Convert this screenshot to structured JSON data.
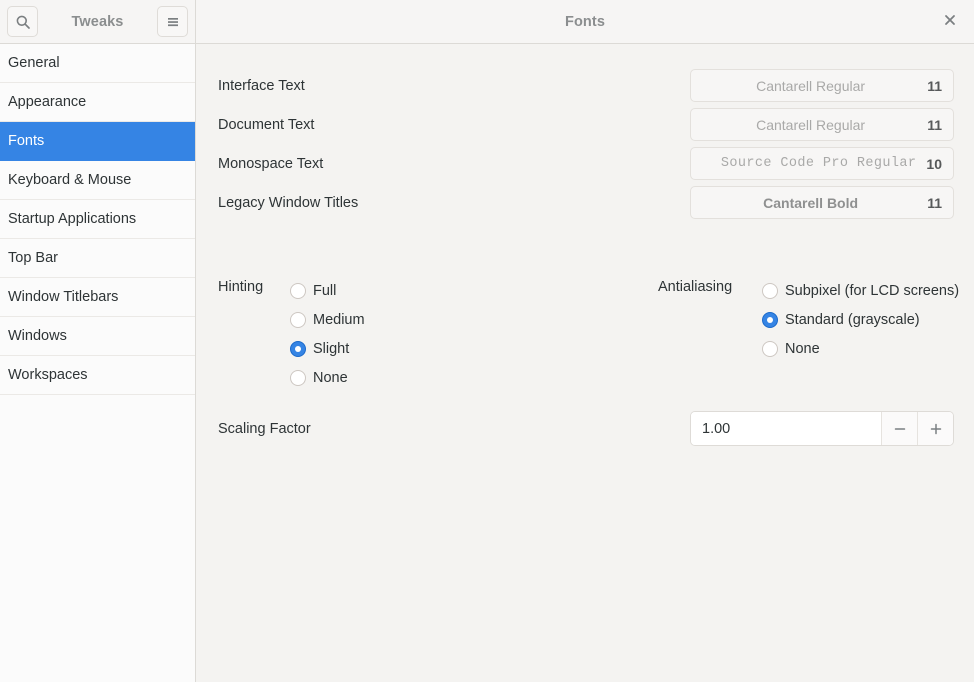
{
  "window": {
    "app_title": "Tweaks",
    "page_title": "Fonts",
    "search_icon": "search-icon",
    "menu_icon": "hamburger-menu-icon",
    "close_icon": "close-icon",
    "accent_color": "#3584e4"
  },
  "sidebar": {
    "items": [
      {
        "label": "General",
        "selected": false
      },
      {
        "label": "Appearance",
        "selected": false
      },
      {
        "label": "Fonts",
        "selected": true
      },
      {
        "label": "Keyboard & Mouse",
        "selected": false
      },
      {
        "label": "Startup Applications",
        "selected": false
      },
      {
        "label": "Top Bar",
        "selected": false
      },
      {
        "label": "Window Titlebars",
        "selected": false
      },
      {
        "label": "Windows",
        "selected": false
      },
      {
        "label": "Workspaces",
        "selected": false
      }
    ]
  },
  "fonts": {
    "rows": [
      {
        "label": "Interface Text",
        "font_name": "Cantarell Regular",
        "size": "11",
        "style": "regular"
      },
      {
        "label": "Document Text",
        "font_name": "Cantarell Regular",
        "size": "11",
        "style": "regular"
      },
      {
        "label": "Monospace Text",
        "font_name": "Source Code Pro Regular",
        "size": "10",
        "style": "mono"
      },
      {
        "label": "Legacy Window Titles",
        "font_name": "Cantarell Bold",
        "size": "11",
        "style": "bold"
      }
    ]
  },
  "hinting": {
    "label": "Hinting",
    "options": [
      {
        "label": "Full",
        "checked": false
      },
      {
        "label": "Medium",
        "checked": false
      },
      {
        "label": "Slight",
        "checked": true
      },
      {
        "label": "None",
        "checked": false
      }
    ]
  },
  "antialiasing": {
    "label": "Antialiasing",
    "options": [
      {
        "label": "Subpixel (for LCD screens)",
        "checked": false
      },
      {
        "label": "Standard (grayscale)",
        "checked": true
      },
      {
        "label": "None",
        "checked": false
      }
    ]
  },
  "scaling": {
    "label": "Scaling Factor",
    "value": "1.00",
    "decrement_icon": "minus-icon",
    "increment_icon": "plus-icon"
  }
}
